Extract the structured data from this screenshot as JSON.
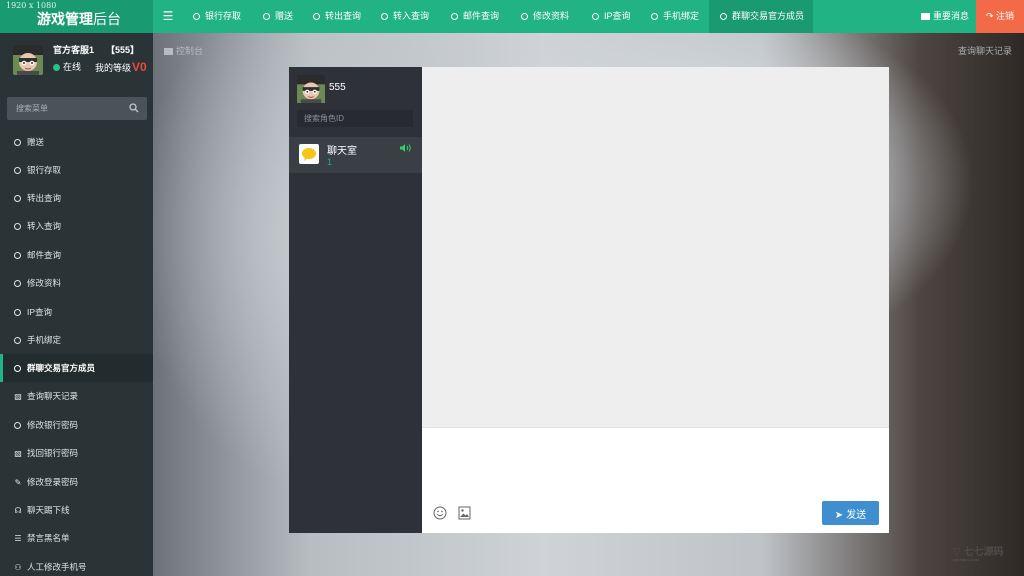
{
  "resolution": "1920 x 1080",
  "brand": {
    "title_bold": "游戏管理",
    "title_light": "后台"
  },
  "top_nav": [
    {
      "label": "银行存取"
    },
    {
      "label": "赠送"
    },
    {
      "label": "转出查询"
    },
    {
      "label": "转入查询"
    },
    {
      "label": "邮件查询"
    },
    {
      "label": "修改资料"
    },
    {
      "label": "IP查询"
    },
    {
      "label": "手机绑定"
    },
    {
      "label": "群聊交易官方成员",
      "active": true
    }
  ],
  "top_right": {
    "messages_label": "重要消息",
    "logout_label": "注销"
  },
  "user": {
    "name": "官方客服1",
    "id": "【555】",
    "status": "在线",
    "level_label": "我的等级",
    "level_value": "V0"
  },
  "sidebar": {
    "search_placeholder": "搜索菜单",
    "items": [
      {
        "label": "赠送",
        "icon": "circle-icon"
      },
      {
        "label": "银行存取",
        "icon": "circle-icon"
      },
      {
        "label": "转出查询",
        "icon": "circle-icon"
      },
      {
        "label": "转入查询",
        "icon": "circle-icon"
      },
      {
        "label": "邮件查询",
        "icon": "circle-icon"
      },
      {
        "label": "修改资料",
        "icon": "circle-icon"
      },
      {
        "label": "IP查询",
        "icon": "circle-icon"
      },
      {
        "label": "手机绑定",
        "icon": "circle-icon"
      },
      {
        "label": "群聊交易官方成员",
        "icon": "circle-icon",
        "active": true
      },
      {
        "label": "查询聊天记录",
        "icon": "folder-icon"
      },
      {
        "label": "修改银行密码",
        "icon": "circle-icon"
      },
      {
        "label": "找回银行密码",
        "icon": "folder-icon"
      },
      {
        "label": "修改登录密码",
        "icon": "pencil-icon"
      },
      {
        "label": "聊天踢下线",
        "icon": "walker-icon"
      },
      {
        "label": "禁言黑名单",
        "icon": "list-icon"
      },
      {
        "label": "人工修改手机号",
        "icon": "binoculars-icon"
      }
    ]
  },
  "breadcrumb": {
    "label": "控制台"
  },
  "history_link": {
    "label": "查询聊天记录"
  },
  "chat": {
    "username": "555",
    "search_placeholder": "搜索角色ID",
    "room": {
      "name": "聊天室",
      "count": "1"
    },
    "send_label": "发送"
  },
  "colors": {
    "accent": "#21b384",
    "sidebar": "#2a3437",
    "logout": "#f26a48",
    "send": "#3e8ed0"
  }
}
